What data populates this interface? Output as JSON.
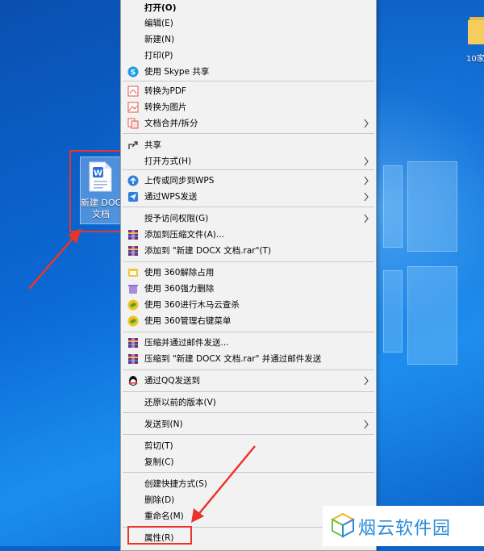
{
  "desktop": {
    "doc_icon": {
      "label_line1": "新建 DOC",
      "label_line2": "文档",
      "icon": "word-document-icon"
    },
    "folder_icon": {
      "label": "10家",
      "icon": "folder-icon"
    }
  },
  "menu": {
    "items": [
      {
        "label": "打开(O)",
        "icon": "",
        "submenu": false
      },
      {
        "label": "编辑(E)",
        "icon": "",
        "submenu": false
      },
      {
        "label": "新建(N)",
        "icon": "",
        "submenu": false
      },
      {
        "label": "打印(P)",
        "icon": "",
        "submenu": false
      },
      {
        "label": "使用 Skype 共享",
        "icon": "skype-icon",
        "submenu": false
      },
      {
        "label": "转换为PDF",
        "icon": "pdf-convert-icon",
        "submenu": false
      },
      {
        "label": "转换为图片",
        "icon": "image-convert-icon",
        "submenu": false
      },
      {
        "label": "文档合并/拆分",
        "icon": "merge-split-icon",
        "submenu": true
      },
      {
        "label": "共享",
        "icon": "share-icon",
        "submenu": false
      },
      {
        "label": "打开方式(H)",
        "icon": "",
        "submenu": true
      },
      {
        "label": "上传或同步到WPS",
        "icon": "cloud-upload-icon",
        "submenu": true
      },
      {
        "label": "通过WPS发送",
        "icon": "wps-send-icon",
        "submenu": true
      },
      {
        "label": "授予访问权限(G)",
        "icon": "",
        "submenu": true
      },
      {
        "label": "添加到压缩文件(A)...",
        "icon": "winrar-icon",
        "submenu": false
      },
      {
        "label": "添加到 \"新建 DOCX 文档.rar\"(T)",
        "icon": "winrar-icon",
        "submenu": false
      },
      {
        "label": "使用 360解除占用",
        "icon": "360-unlock-icon",
        "submenu": false
      },
      {
        "label": "使用 360强力删除",
        "icon": "360-delete-icon",
        "submenu": false
      },
      {
        "label": "使用 360进行木马云查杀",
        "icon": "360-scan-icon",
        "submenu": false
      },
      {
        "label": "使用 360管理右键菜单",
        "icon": "360-manage-icon",
        "submenu": false
      },
      {
        "label": "压缩并通过邮件发送...",
        "icon": "winrar-icon",
        "submenu": false
      },
      {
        "label": "压缩到 \"新建 DOCX 文档.rar\" 并通过邮件发送",
        "icon": "winrar-icon",
        "submenu": false
      },
      {
        "label": "通过QQ发送到",
        "icon": "qq-icon",
        "submenu": true
      },
      {
        "label": "还原以前的版本(V)",
        "icon": "",
        "submenu": false
      },
      {
        "label": "发送到(N)",
        "icon": "",
        "submenu": true
      },
      {
        "label": "剪切(T)",
        "icon": "",
        "submenu": false
      },
      {
        "label": "复制(C)",
        "icon": "",
        "submenu": false
      },
      {
        "label": "创建快捷方式(S)",
        "icon": "",
        "submenu": false
      },
      {
        "label": "删除(D)",
        "icon": "",
        "submenu": false
      },
      {
        "label": "重命名(M)",
        "icon": "",
        "submenu": false
      },
      {
        "label": "属性(R)",
        "icon": "",
        "submenu": false
      }
    ]
  },
  "watermark": {
    "text": "烟云软件园",
    "icon": "cube-logo-icon"
  },
  "colors": {
    "highlight_red": "#e8352b",
    "menu_bg": "#f2f2f2",
    "watermark_blue": "#2a8bd8"
  }
}
